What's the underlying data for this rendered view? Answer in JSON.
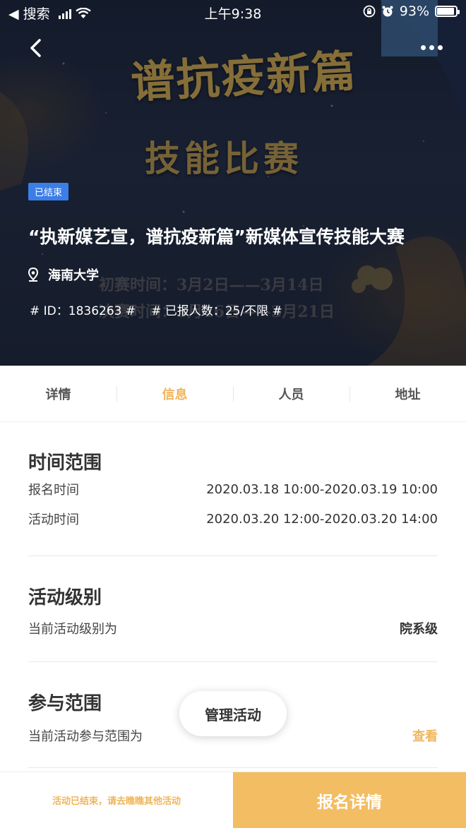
{
  "status_bar": {
    "back_app": "◀ 搜索",
    "time": "上午9:38",
    "battery": "93%",
    "battery_level": 0.93
  },
  "poster": {
    "title_line": "谱抗疫新篇",
    "subtitle": "技能比赛",
    "date_line_1": "初赛时间：3月2日——3月14日",
    "date_line_2": "决赛时间：3月16日——3月21日"
  },
  "event": {
    "status_badge": "已结束",
    "title": "“执新媒艺宣，谱抗疫新篇”新媒体宣传技能大赛",
    "location": "海南大学",
    "id_tag": "# ID：1836263 #",
    "registered_tag": "# 已报人数：25/不限 #"
  },
  "tabs": [
    {
      "label": "详情",
      "active": false
    },
    {
      "label": "信息",
      "active": true
    },
    {
      "label": "人员",
      "active": false
    },
    {
      "label": "地址",
      "active": false
    }
  ],
  "time_range": {
    "title": "时间范围",
    "signup_label": "报名时间",
    "signup_value": "2020.03.18 10:00-2020.03.19 10:00",
    "activity_label": "活动时间",
    "activity_value": "2020.03.20 12:00-2020.03.20 14:00"
  },
  "level": {
    "title": "活动级别",
    "label": "当前活动级别为",
    "value": "院系级"
  },
  "scope": {
    "title": "参与范围",
    "label": "当前活动参与范围为",
    "link": "查看"
  },
  "manage_button": "管理活动",
  "bottom": {
    "note": "活动已结束，请去瞧瞧其他活动",
    "button": "报名详情"
  },
  "colors": {
    "accent": "#f0b55a",
    "badge": "#3c7ee8",
    "button_bg": "#f3bd63"
  }
}
